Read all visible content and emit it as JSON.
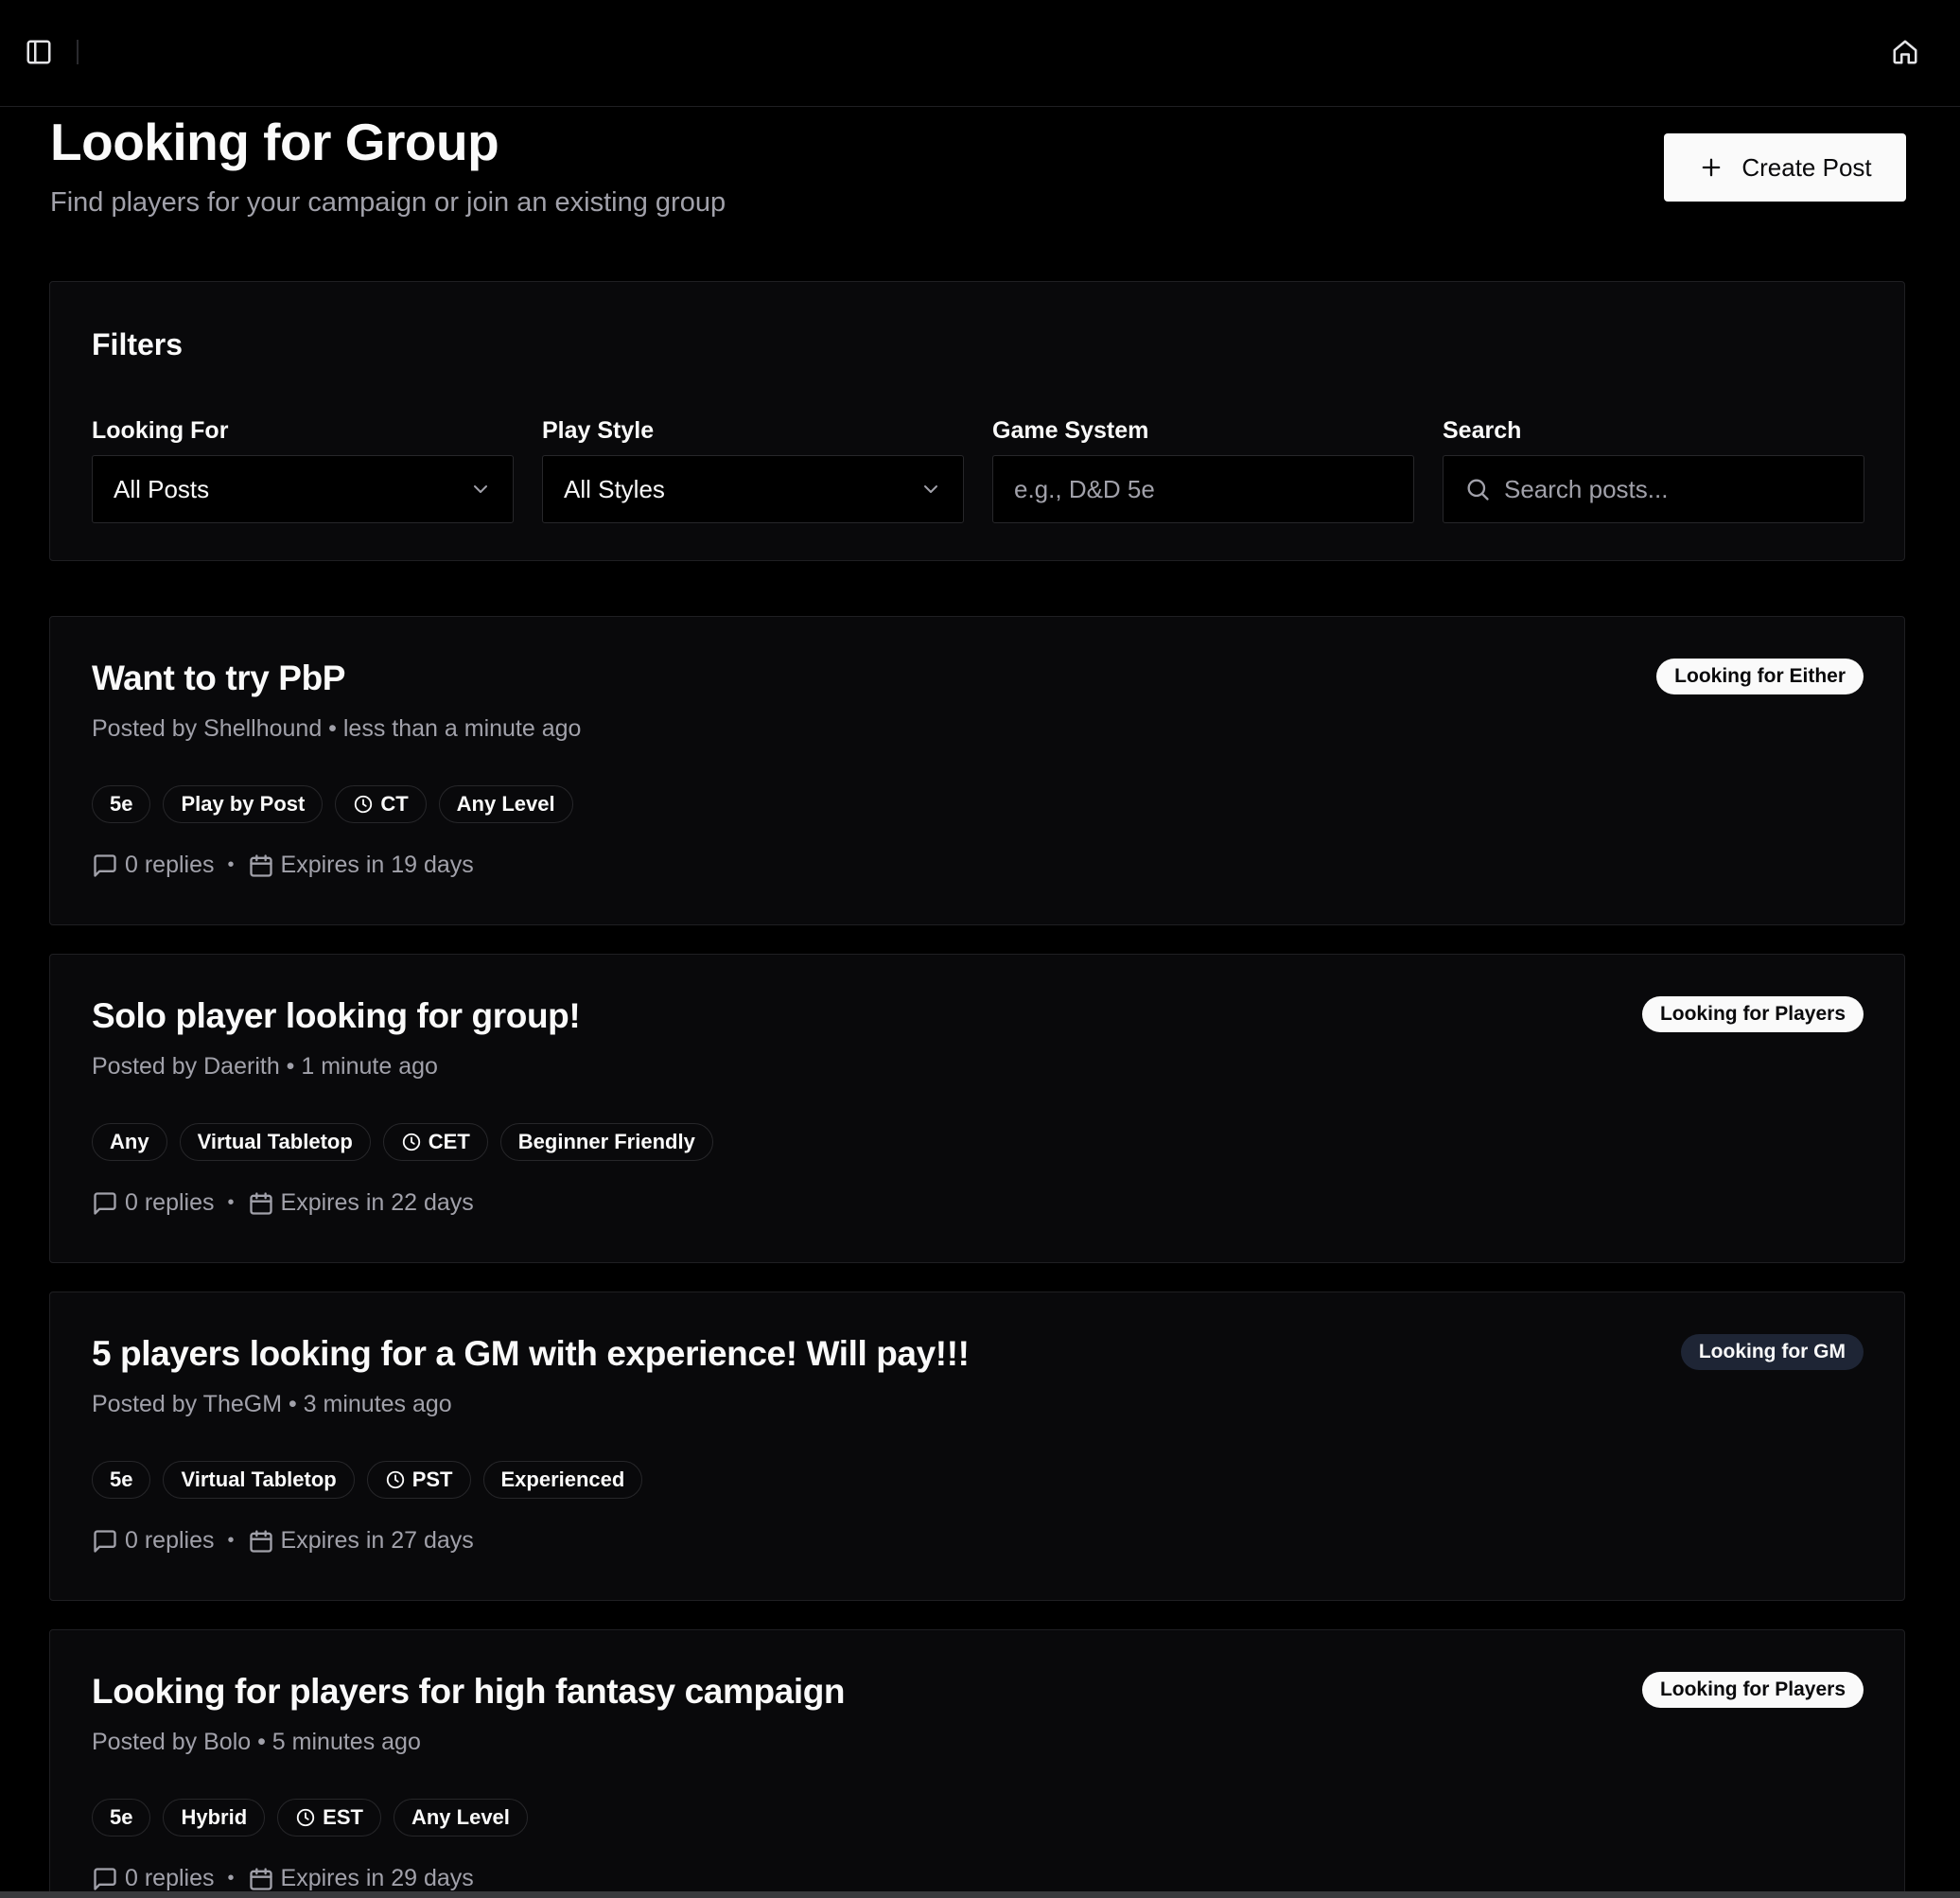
{
  "header": {
    "title": "Looking for Group",
    "subtitle": "Find players for your campaign or join an existing group",
    "create_label": "Create Post"
  },
  "filters": {
    "title": "Filters",
    "looking_for": {
      "label": "Looking For",
      "value": "All Posts"
    },
    "play_style": {
      "label": "Play Style",
      "value": "All Styles"
    },
    "game_system": {
      "label": "Game System",
      "placeholder": "e.g., D&D 5e"
    },
    "search": {
      "label": "Search",
      "placeholder": "Search posts..."
    }
  },
  "posts": [
    {
      "title": "Want to try PbP",
      "meta": "Posted by Shellhound • less than a minute ago",
      "badge": "Looking for Either",
      "badge_style": "light",
      "tags": [
        "5e",
        "Play by Post",
        "CT",
        "Any Level"
      ],
      "replies": "0 replies",
      "expires": "Expires in 19 days"
    },
    {
      "title": "Solo player looking for group!",
      "meta": "Posted by Daerith • 1 minute ago",
      "badge": "Looking for Players",
      "badge_style": "light",
      "tags": [
        "Any",
        "Virtual Tabletop",
        "CET",
        "Beginner Friendly"
      ],
      "replies": "0 replies",
      "expires": "Expires in 22 days"
    },
    {
      "title": "5 players looking for a GM with experience! Will pay!!!",
      "meta": "Posted by TheGM • 3 minutes ago",
      "badge": "Looking for GM",
      "badge_style": "dark",
      "tags": [
        "5e",
        "Virtual Tabletop",
        "PST",
        "Experienced"
      ],
      "replies": "0 replies",
      "expires": "Expires in 27 days"
    },
    {
      "title": "Looking for players for high fantasy campaign",
      "meta": "Posted by Bolo • 5 minutes ago",
      "badge": "Looking for Players",
      "badge_style": "light",
      "tags": [
        "5e",
        "Hybrid",
        "EST",
        "Any Level"
      ],
      "replies": "0 replies",
      "expires": "Expires in 29 days"
    }
  ],
  "icons": {
    "sidebar_toggle": "panel-left-icon",
    "home": "home-icon",
    "create": "plus-icon",
    "chevron": "chevron-down-icon",
    "search": "search-icon",
    "timezone": "clock-icon",
    "replies": "message-square-icon",
    "expires": "calendar-icon"
  }
}
